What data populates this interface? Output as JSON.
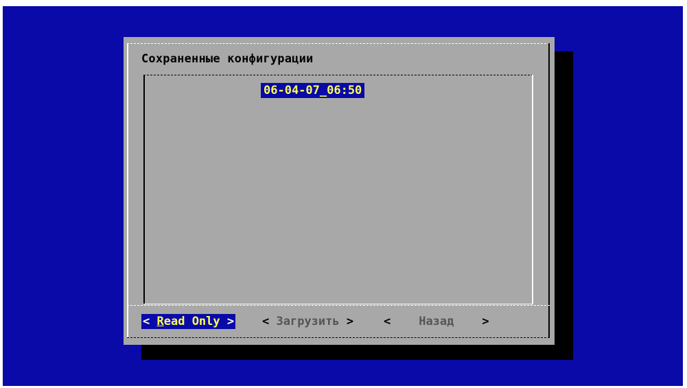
{
  "dialog": {
    "title": "Сохраненные конфигурации",
    "list_items": [
      {
        "label": "06-04-07_06:50",
        "selected": true
      }
    ],
    "buttons": [
      {
        "open": "<",
        "hotkey": "R",
        "label": "ead Only",
        "close": ">",
        "focused": true
      },
      {
        "open": "<",
        "label": "Загрузить",
        "close": ">",
        "focused": false
      },
      {
        "open": "<",
        "label": "Назад",
        "close": ">",
        "focused": false
      }
    ]
  },
  "colors": {
    "screen_bg": "#0a0aa8",
    "dialog_bg": "#a8a8a8",
    "highlight_text": "#ffff55",
    "disabled_text": "#555555"
  }
}
